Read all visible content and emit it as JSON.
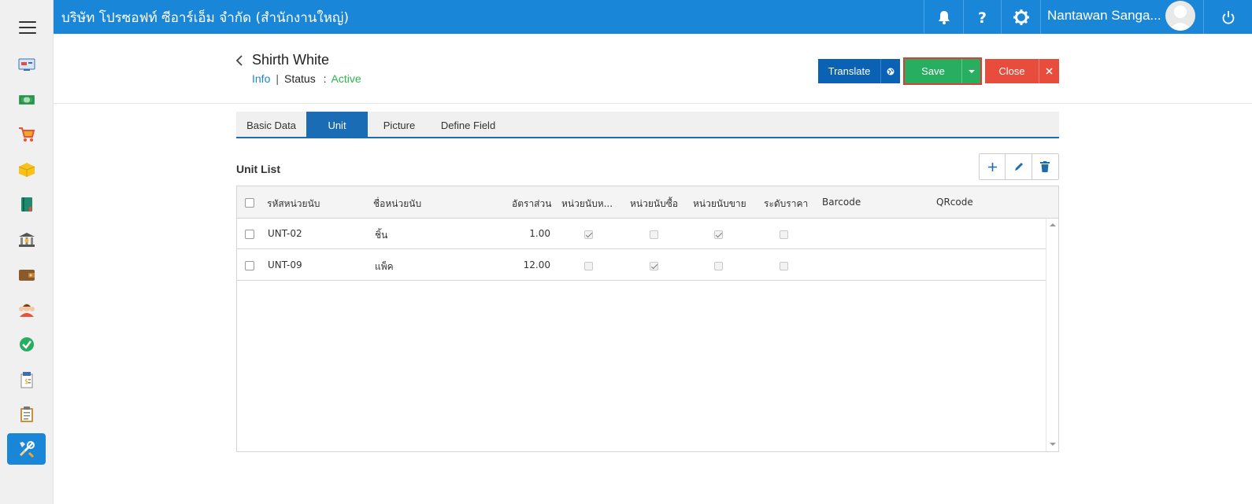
{
  "topbar": {
    "company": "บริษัท โปรซอฟท์ ซีอาร์เอ็ม จำกัด (สำนักงานใหญ่)",
    "username": "Nantawan Sanga...",
    "icons": [
      "bell-icon",
      "help-icon",
      "gear-icon",
      "avatar",
      "power-icon"
    ]
  },
  "sidebar": {
    "items": [
      "menu-icon",
      "dashboard-icon",
      "money-icon",
      "cart-icon",
      "box-icon",
      "book-icon",
      "bank-icon",
      "wallet-icon",
      "users-icon",
      "check-icon",
      "invoice-icon",
      "clipboard-icon",
      "settings-tools-icon"
    ]
  },
  "header": {
    "title": "Shirth White",
    "info_label": "Info",
    "separator": "|",
    "status_label": "Status",
    "colon": ":",
    "status_value": "Active"
  },
  "buttons": {
    "translate": "Translate",
    "save": "Save",
    "close": "Close"
  },
  "tabs": [
    "Basic Data",
    "Unit",
    "Picture",
    "Define Field"
  ],
  "active_tab": "Unit",
  "unit_list": {
    "title": "Unit List",
    "columns": [
      "รหัสหน่วยนับ",
      "ชื่อหน่วยนับ",
      "อัตราส่วน",
      "หน่วยนับห...",
      "หน่วยนับซื้อ",
      "หน่วยนับขาย",
      "ระดับราคา",
      "Barcode",
      "QRcode"
    ],
    "rows": [
      {
        "code": "UNT-02",
        "name": "ชิ้น",
        "ratio": "1.00",
        "base": true,
        "buy": false,
        "sell": true,
        "price_level": false
      },
      {
        "code": "UNT-09",
        "name": "แพ็ค",
        "ratio": "12.00",
        "base": false,
        "buy": true,
        "sell": false,
        "price_level": false
      }
    ]
  },
  "colors": {
    "primary": "#1a86d8",
    "tab_active": "#1a6cb5",
    "translate": "#0b62b5",
    "save": "#27ae60",
    "close": "#e74c3c",
    "active_status": "#2eb54b"
  }
}
